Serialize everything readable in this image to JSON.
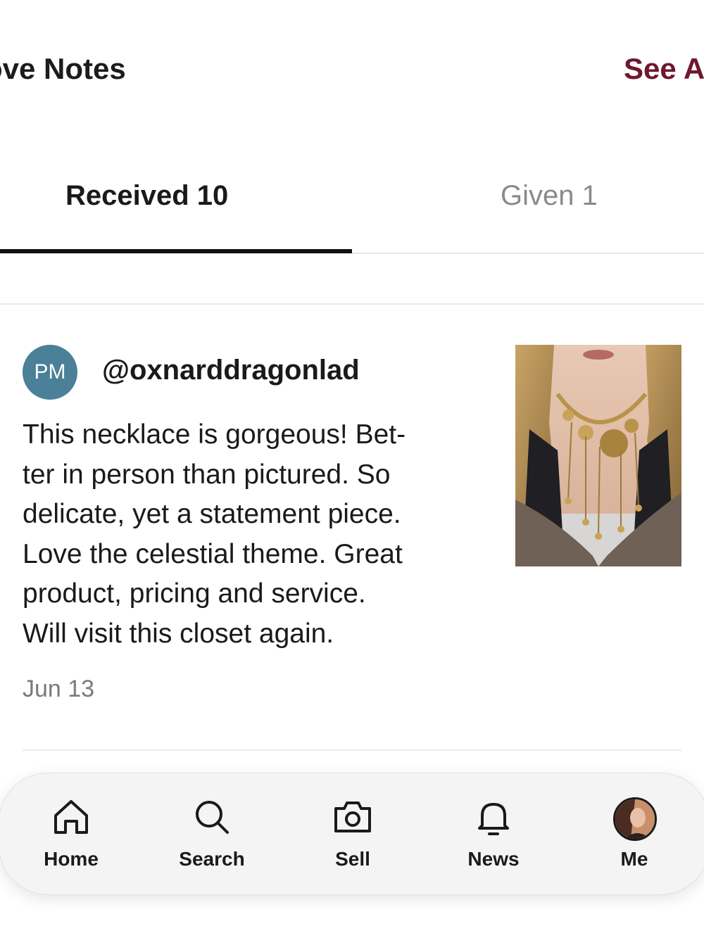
{
  "header": {
    "title": "ove Notes",
    "see_all": "See A"
  },
  "tabs": [
    {
      "label": "Received 10",
      "selected": true
    },
    {
      "label": "Given 1",
      "selected": false
    }
  ],
  "note": {
    "avatar_initials": "PM",
    "username": "@oxnarddragonlad",
    "text_lines": [
      "This necklace is gorgeous! Bet-",
      "ter in person than pictured. So",
      "delicate, yet a statement piece.",
      "Love the celestial theme. Great",
      "product, pricing and service.",
      "Will visit this closet again."
    ],
    "date": "Jun 13",
    "image": "necklace-photo"
  },
  "bottom_nav": [
    {
      "label": "Home",
      "icon": "home-icon"
    },
    {
      "label": "Search",
      "icon": "search-icon"
    },
    {
      "label": "Sell",
      "icon": "camera-icon"
    },
    {
      "label": "News",
      "icon": "bell-icon"
    },
    {
      "label": "Me",
      "icon": "profile-avatar"
    }
  ],
  "colors": {
    "accent": "#6e1731",
    "avatar_bg": "#4a8098",
    "date": "#7a7a7a"
  }
}
